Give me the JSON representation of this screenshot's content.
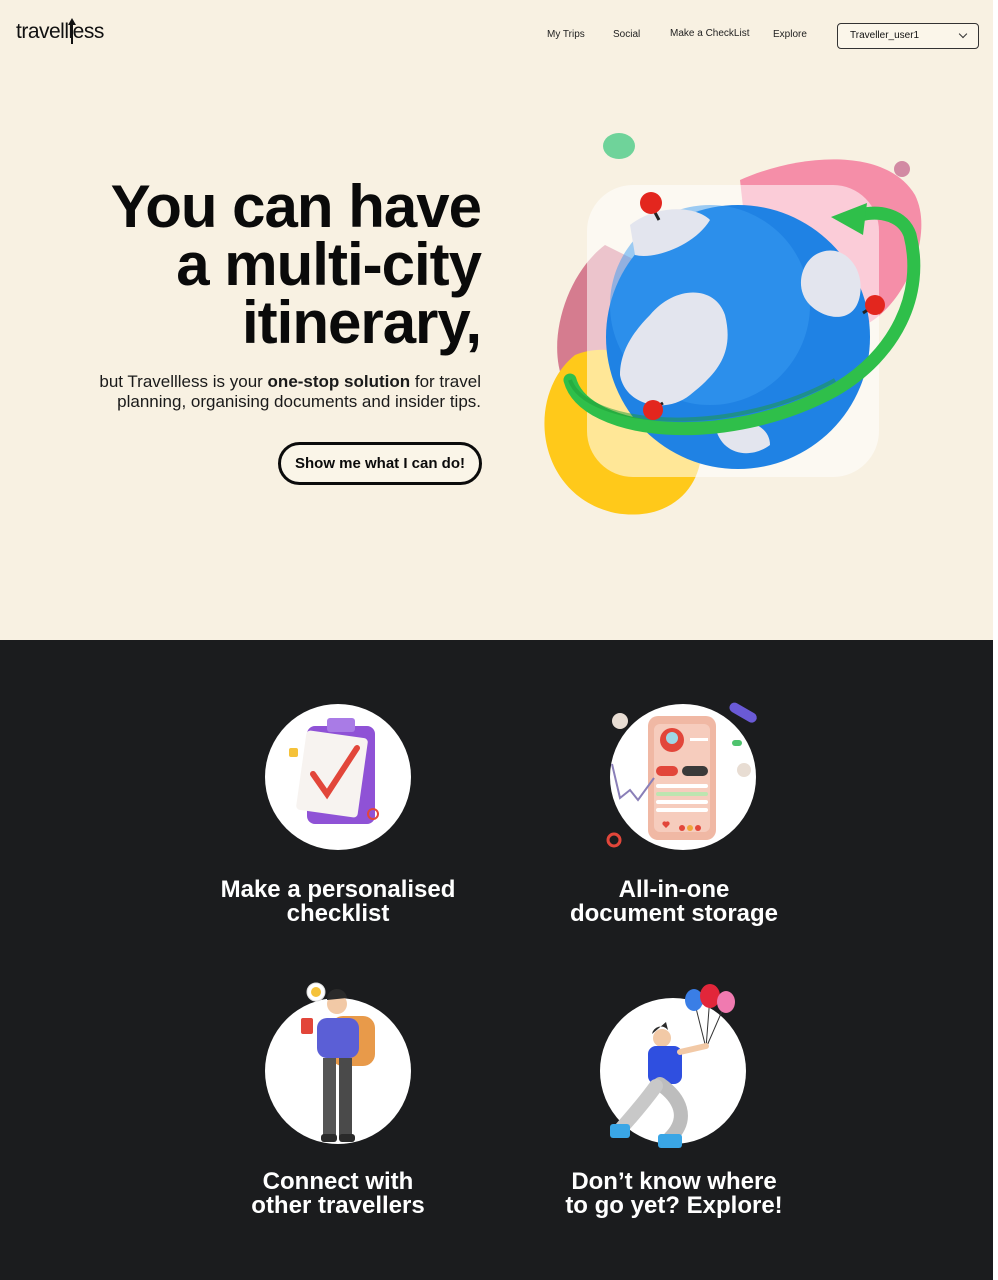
{
  "brand": {
    "logo_text": "travellless"
  },
  "nav": {
    "items": [
      {
        "label": "My Trips"
      },
      {
        "label": "Social"
      },
      {
        "label": "Make a CheckList"
      },
      {
        "label": "Explore"
      }
    ],
    "user_select": {
      "value": "Traveller_user1"
    }
  },
  "hero": {
    "headline": [
      "You can have",
      "a multi-city",
      "itinerary,"
    ],
    "sub_before": "but Travellless is your ",
    "sub_bold": "one-stop solution",
    "sub_after": " for travel planning, organising documents and insider tips.",
    "cta_label": "Show me what I can do!"
  },
  "features": [
    {
      "title_lines": [
        "Make a personalised",
        "checklist"
      ],
      "icon": "checklist-clipboard-icon"
    },
    {
      "title_lines": [
        "All-in-one",
        "document storage"
      ],
      "icon": "phone-documents-icon"
    },
    {
      "title_lines": [
        "Connect with",
        "other travellers"
      ],
      "icon": "traveller-person-icon"
    },
    {
      "title_lines": [
        "Don’t know where",
        "to go yet? Explore!"
      ],
      "icon": "balloons-person-icon"
    }
  ],
  "colors": {
    "hero_bg": "#f8f1e2",
    "dark_bg": "#1b1c1e",
    "globe_blue": "#1e7fe0",
    "ring_green": "#2fbf4a",
    "blob_pink": "#f48aa6",
    "blob_yellow": "#ffcc1a",
    "pin_red": "#e3261e"
  }
}
